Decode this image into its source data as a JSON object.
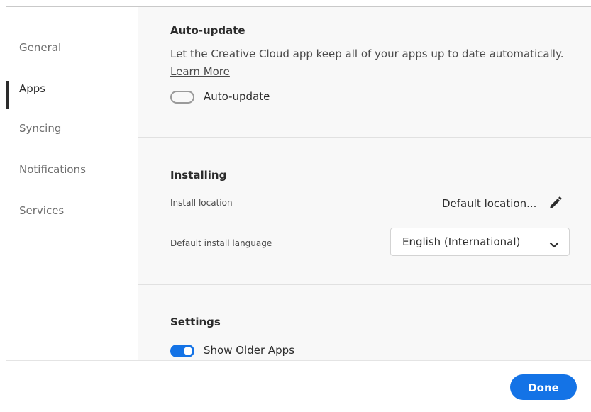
{
  "sidebar": {
    "items": [
      {
        "label": "General"
      },
      {
        "label": "Apps"
      },
      {
        "label": "Syncing"
      },
      {
        "label": "Notifications"
      },
      {
        "label": "Services"
      }
    ],
    "active": "Apps"
  },
  "auto_update": {
    "title": "Auto-update",
    "description": "Let the Creative Cloud app keep all of your apps up to date automatically.",
    "learn_more": "Learn More",
    "toggle_label": "Auto-update",
    "toggle_on": false
  },
  "installing": {
    "title": "Installing",
    "install_location_label": "Install location",
    "install_location_value": "Default location...",
    "language_label": "Default install language",
    "language_value": "English (International)"
  },
  "settings": {
    "title": "Settings",
    "toggle_label": "Show Older Apps",
    "toggle_on": true
  },
  "footer": {
    "done_label": "Done"
  },
  "colors": {
    "accent": "#1473e6",
    "content_bg": "#f8f8f8"
  },
  "icons": [
    "pencil-icon",
    "chevron-down-icon"
  ]
}
